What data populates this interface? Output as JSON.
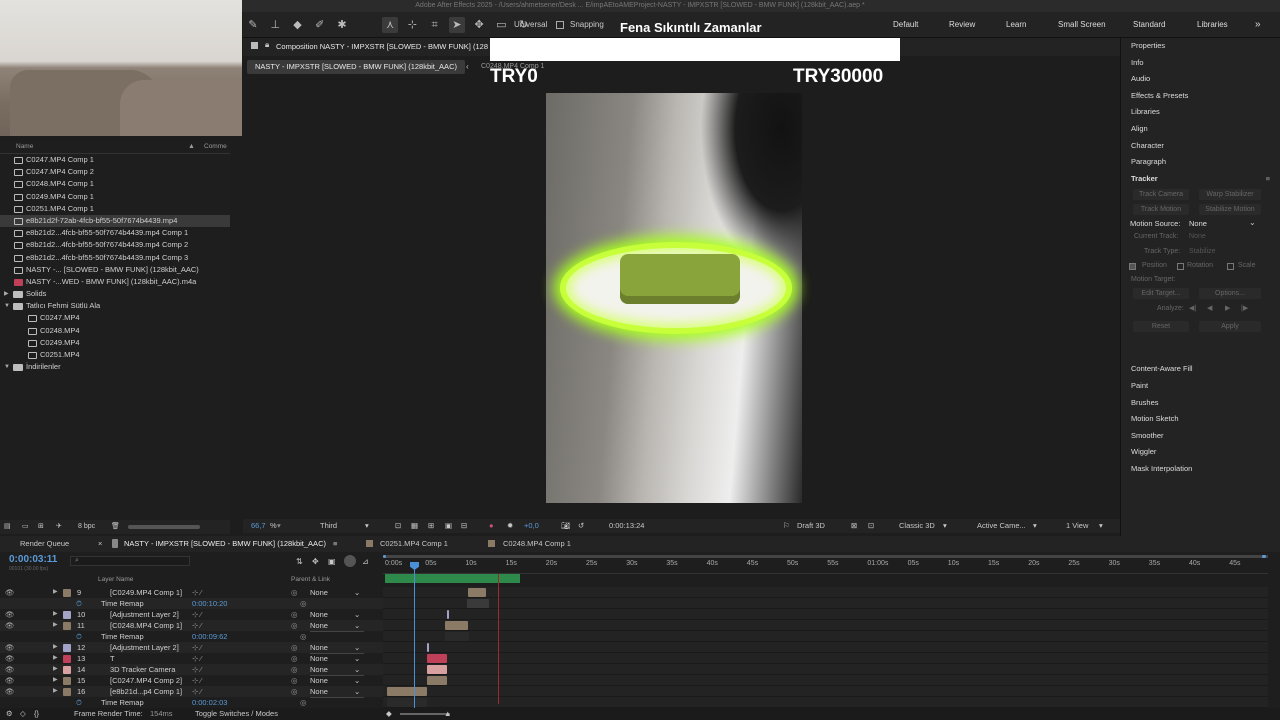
{
  "app_title": "Adobe After Effects 2025 - /Users/ahmetsener/Desk ... E/impAEtoAMEProject-NASTY - IMPXSTR [SLOWED - BMW FUNK] (128kbit_AAC).aep *",
  "toolbar": {
    "universal_label": "Universal",
    "snapping_label": "Snapping",
    "workspaces": [
      "Default",
      "Review",
      "Learn",
      "Small Screen",
      "Standard",
      "Libraries"
    ]
  },
  "overlay": {
    "title": "Fena Sıkıntılı Zamanlar",
    "left_amount": "TRY0",
    "right_amount": "TRY30000"
  },
  "project": {
    "col_name": "Name",
    "col_comment": "Comme",
    "items": [
      {
        "label": "C0247.MP4 Comp 1",
        "type": "comp",
        "indent": false
      },
      {
        "label": "C0247.MP4 Comp 2",
        "type": "comp",
        "indent": false
      },
      {
        "label": "C0248.MP4 Comp 1",
        "type": "comp",
        "indent": false
      },
      {
        "label": "C0249.MP4 Comp 1",
        "type": "comp",
        "indent": false
      },
      {
        "label": "C0251.MP4 Comp 1",
        "type": "comp",
        "indent": false
      },
      {
        "label": "e8b21d2f-72ab-4fcb-bf55-50f7674b4439.mp4",
        "type": "file",
        "indent": false,
        "selected": true
      },
      {
        "label": "e8b21d2...4fcb-bf55-50f7674b4439.mp4 Comp 1",
        "type": "comp",
        "indent": false
      },
      {
        "label": "e8b21d2...4fcb-bf55-50f7674b4439.mp4 Comp 2",
        "type": "comp",
        "indent": false
      },
      {
        "label": "e8b21d2...4fcb-bf55-50f7674b4439.mp4 Comp 3",
        "type": "comp",
        "indent": false
      },
      {
        "label": "NASTY -... [SLOWED - BMW FUNK] (128kbit_AAC)",
        "type": "comp",
        "indent": false
      },
      {
        "label": "NASTY -...WED - BMW FUNK] (128kbit_AAC).m4a",
        "type": "audio",
        "indent": false
      },
      {
        "label": "Solids",
        "type": "folder",
        "indent": false
      },
      {
        "label": "Tatlıcı Fehmi Sütlü Ala",
        "type": "folder",
        "indent": false
      },
      {
        "label": "C0247.MP4",
        "type": "file",
        "indent": true
      },
      {
        "label": "C0248.MP4",
        "type": "file",
        "indent": true
      },
      {
        "label": "C0249.MP4",
        "type": "file",
        "indent": true
      },
      {
        "label": "C0251.MP4",
        "type": "file",
        "indent": true
      },
      {
        "label": "İndirilenler",
        "type": "folder",
        "indent": false
      }
    ],
    "bpc_label": "8 bpc"
  },
  "composition": {
    "tab_label": "Composition NASTY - IMPXSTR [SLOWED - BMW FUNK] (128",
    "sub_tab_active": "NASTY - IMPXSTR [SLOWED - BMW FUNK] (128kbit_AAC)",
    "sub_tab_other": "C0248.MP4 Comp 1"
  },
  "viewer_bar": {
    "zoom": "66,7",
    "zoom_unit": "%",
    "resolution": "Third",
    "exposure": "+0,0",
    "timecode": "0:00:13:24",
    "renderer": "Draft 3D",
    "view_mode": "Classic 3D",
    "camera": "Active Came...",
    "views": "1 View"
  },
  "panels": {
    "items": [
      "Properties",
      "Info",
      "Audio",
      "Effects & Presets",
      "Libraries",
      "Align",
      "Character",
      "Paragraph"
    ],
    "tracker_title": "Tracker",
    "tracker_buttons": [
      "Track Camera",
      "Warp Stabilizer",
      "Track Motion",
      "Stabilize Motion"
    ],
    "motion_source_label": "Motion Source:",
    "motion_source_value": "None",
    "current_track_label": "Current Track:",
    "current_track_value": "None",
    "track_type_label": "Track Type:",
    "track_type_value": "Stabilize",
    "position_label": "Position",
    "rotation_label": "Rotation",
    "scale_label": "Scale",
    "motion_target_label": "Motion Target:",
    "edit_target_label": "Edit Target...",
    "options_label": "Options...",
    "analyze_label": "Analyze:",
    "reset_label": "Reset",
    "apply_label": "Apply",
    "items_after": [
      "Content-Aware Fill",
      "Paint",
      "Brushes",
      "Motion Sketch",
      "Smoother",
      "Wiggler",
      "Mask Interpolation"
    ]
  },
  "timeline": {
    "tabs": [
      "Render Queue",
      "NASTY - IMPXSTR [SLOWED - BMW FUNK] (128kbit_AAC)",
      "C0251.MP4 Comp 1",
      "C0248.MP4 Comp 1"
    ],
    "current_time": "0:00:03:11",
    "fps": "00101 (30.00 fps)",
    "col_layer_name": "Layer Name",
    "col_parent": "Parent & Link",
    "ruler_ticks": [
      "0:00s",
      "05s",
      "10s",
      "15s",
      "20s",
      "25s",
      "30s",
      "35s",
      "40s",
      "45s",
      "50s",
      "55s",
      "01:00s",
      "05s",
      "10s",
      "15s",
      "20s",
      "25s",
      "30s",
      "35s",
      "40s",
      "45s"
    ],
    "layers": [
      {
        "num": "9",
        "name": "[C0249.MP4 Comp 1]",
        "color": "#8a7a66",
        "parent": "None",
        "sub": false
      },
      {
        "num": "",
        "name": "Time Remap",
        "color": "",
        "parent": "",
        "sub": true,
        "value": "0:00:10:20"
      },
      {
        "num": "10",
        "name": "[Adjustment Layer 2]",
        "color": "#a3a3c8",
        "parent": "None",
        "sub": false
      },
      {
        "num": "11",
        "name": "[C0248.MP4 Comp 1]",
        "color": "#8a7a66",
        "parent": "None",
        "sub": false
      },
      {
        "num": "",
        "name": "Time Remap",
        "color": "",
        "parent": "",
        "sub": true,
        "value": "0:00:09:62"
      },
      {
        "num": "12",
        "name": "[Adjustment Layer 2]",
        "color": "#a3a3c8",
        "parent": "None",
        "sub": false
      },
      {
        "num": "13",
        "name": "T",
        "color": "#c0405a",
        "parent": "None",
        "sub": false
      },
      {
        "num": "14",
        "name": "3D Tracker Camera",
        "color": "#d9a0a0",
        "parent": "None",
        "sub": false
      },
      {
        "num": "15",
        "name": "[C0247.MP4 Comp 2]",
        "color": "#8a7a66",
        "parent": "None",
        "sub": false
      },
      {
        "num": "16",
        "name": "[e8b21d...p4 Comp 1]",
        "color": "#8a7a66",
        "parent": "None",
        "sub": false
      },
      {
        "num": "",
        "name": "Time Remap",
        "color": "",
        "parent": "",
        "sub": true,
        "value": "0:00:02:03"
      }
    ]
  },
  "status": {
    "frame_render_label": "Frame Render Time:",
    "frame_render_value": "154ms",
    "toggle_label": "Toggle Switches / Modes"
  }
}
